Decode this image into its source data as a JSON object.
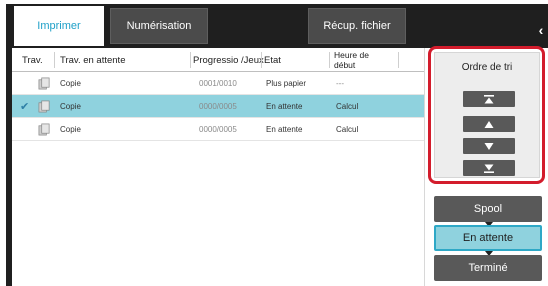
{
  "tabs": [
    {
      "label": "Imprimer",
      "active": true
    },
    {
      "label": "Numérisation",
      "active": false
    },
    {
      "label": "Récup. fichier",
      "active": false
    }
  ],
  "collapse_icon": "chevron-left-icon",
  "table": {
    "headers": {
      "trav": "Trav.",
      "trav_attente": "Trav. en attente",
      "progression": "Progressio /Jeux",
      "etat": "Etat",
      "heure": "Heure de début"
    },
    "rows": [
      {
        "name": "Copie",
        "progress": "0001/0010",
        "status": "Plus papier",
        "start": "---",
        "selected": false
      },
      {
        "name": "Copie",
        "progress": "0000/0005",
        "status": "En attente",
        "start": "Calcul",
        "selected": true
      },
      {
        "name": "Copie",
        "progress": "0000/0005",
        "status": "En attente",
        "start": "Calcul",
        "selected": false
      }
    ]
  },
  "sort": {
    "title": "Ordre de tri",
    "buttons": [
      "move-to-top-icon",
      "move-up-icon",
      "move-down-icon",
      "move-to-bottom-icon"
    ]
  },
  "status_buttons": [
    {
      "label": "Spool",
      "active": false
    },
    {
      "label": "En attente",
      "active": true
    },
    {
      "label": "Terminé",
      "active": false
    }
  ],
  "colors": {
    "accent": "#1fa0c8",
    "selected_row": "#8fd2de",
    "highlight_frame": "#d31c2c",
    "dark_button": "#595959"
  }
}
